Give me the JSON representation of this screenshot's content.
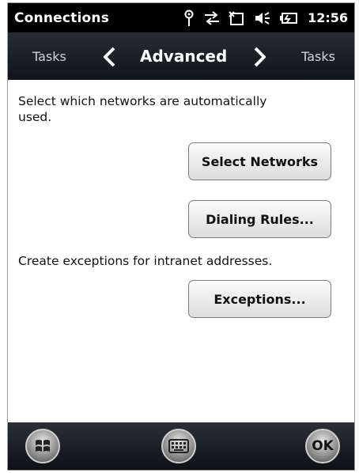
{
  "statusbar": {
    "title": "Connections",
    "time": "12:56"
  },
  "tabnav": {
    "left_label": "Tasks",
    "current_label": "Advanced",
    "right_label": "Tasks"
  },
  "content": {
    "desc1": "Select which networks are automatically used.",
    "button1": "Select Networks",
    "button2": "Dialing Rules...",
    "desc2": "Create exceptions for intranet addresses.",
    "button3": "Exceptions..."
  },
  "bottombar": {
    "ok_label": "OK"
  },
  "icons": [
    "signal-icon",
    "sync-icon",
    "phone-icon",
    "volume-icon",
    "battery-icon",
    "windows-start-icon",
    "keyboard-icon"
  ]
}
